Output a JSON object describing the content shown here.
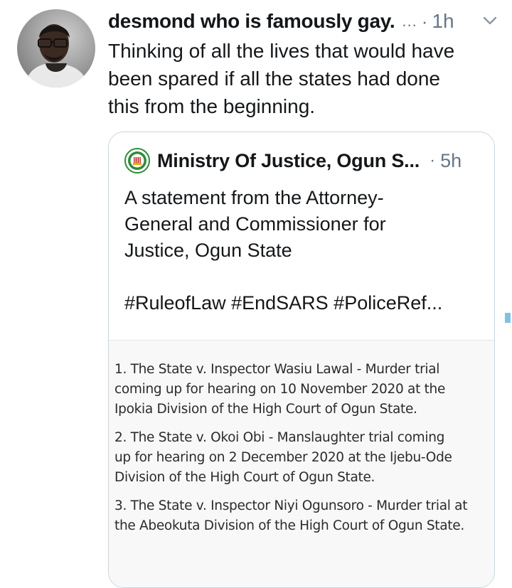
{
  "tweet": {
    "author_name": "desmond who is famously gay.",
    "author_more": "...",
    "separator": "·",
    "time": "1h",
    "text_lines": [
      "Thinking of all the lives that would have",
      "been spared if all the states had done",
      "this from the beginning."
    ],
    "menu_icon": "chevron-down-icon",
    "avatar_icon": "profile-photo"
  },
  "quoted_tweet": {
    "author_name": "Ministry Of Justice, Ogun S...",
    "separator": "·",
    "time": "5h",
    "logo_icon": "ogun-state-seal",
    "text_lines": [
      "A statement from the Attorney-",
      "General and Commissioner for",
      "Justice, Ogun State"
    ],
    "hashtags": "#RuleofLaw #EndSARS #PoliceRef...",
    "document": {
      "items": [
        {
          "lines": [
            "1. The State v. Inspector Wasiu Lawal - Murder trial",
            "coming up for hearing on 10 November 2020 at the",
            "Ipokia Division of the High Court of Ogun State."
          ]
        },
        {
          "lines": [
            "2. The State v. Okoi Obi - Manslaughter trial coming",
            "up for hearing on 2 December 2020 at the Ijebu-Ode",
            "Division of the High Court of Ogun State."
          ]
        },
        {
          "lines": [
            "3. The State v. Inspector Niyi Ogunsoro - Murder trial at",
            "the Abeokuta Division of the High Court of Ogun State."
          ]
        }
      ]
    }
  },
  "colors": {
    "text": "#14171a",
    "secondary": "#657786",
    "border": "#ccd6dd",
    "accent": "#1da1f2"
  }
}
